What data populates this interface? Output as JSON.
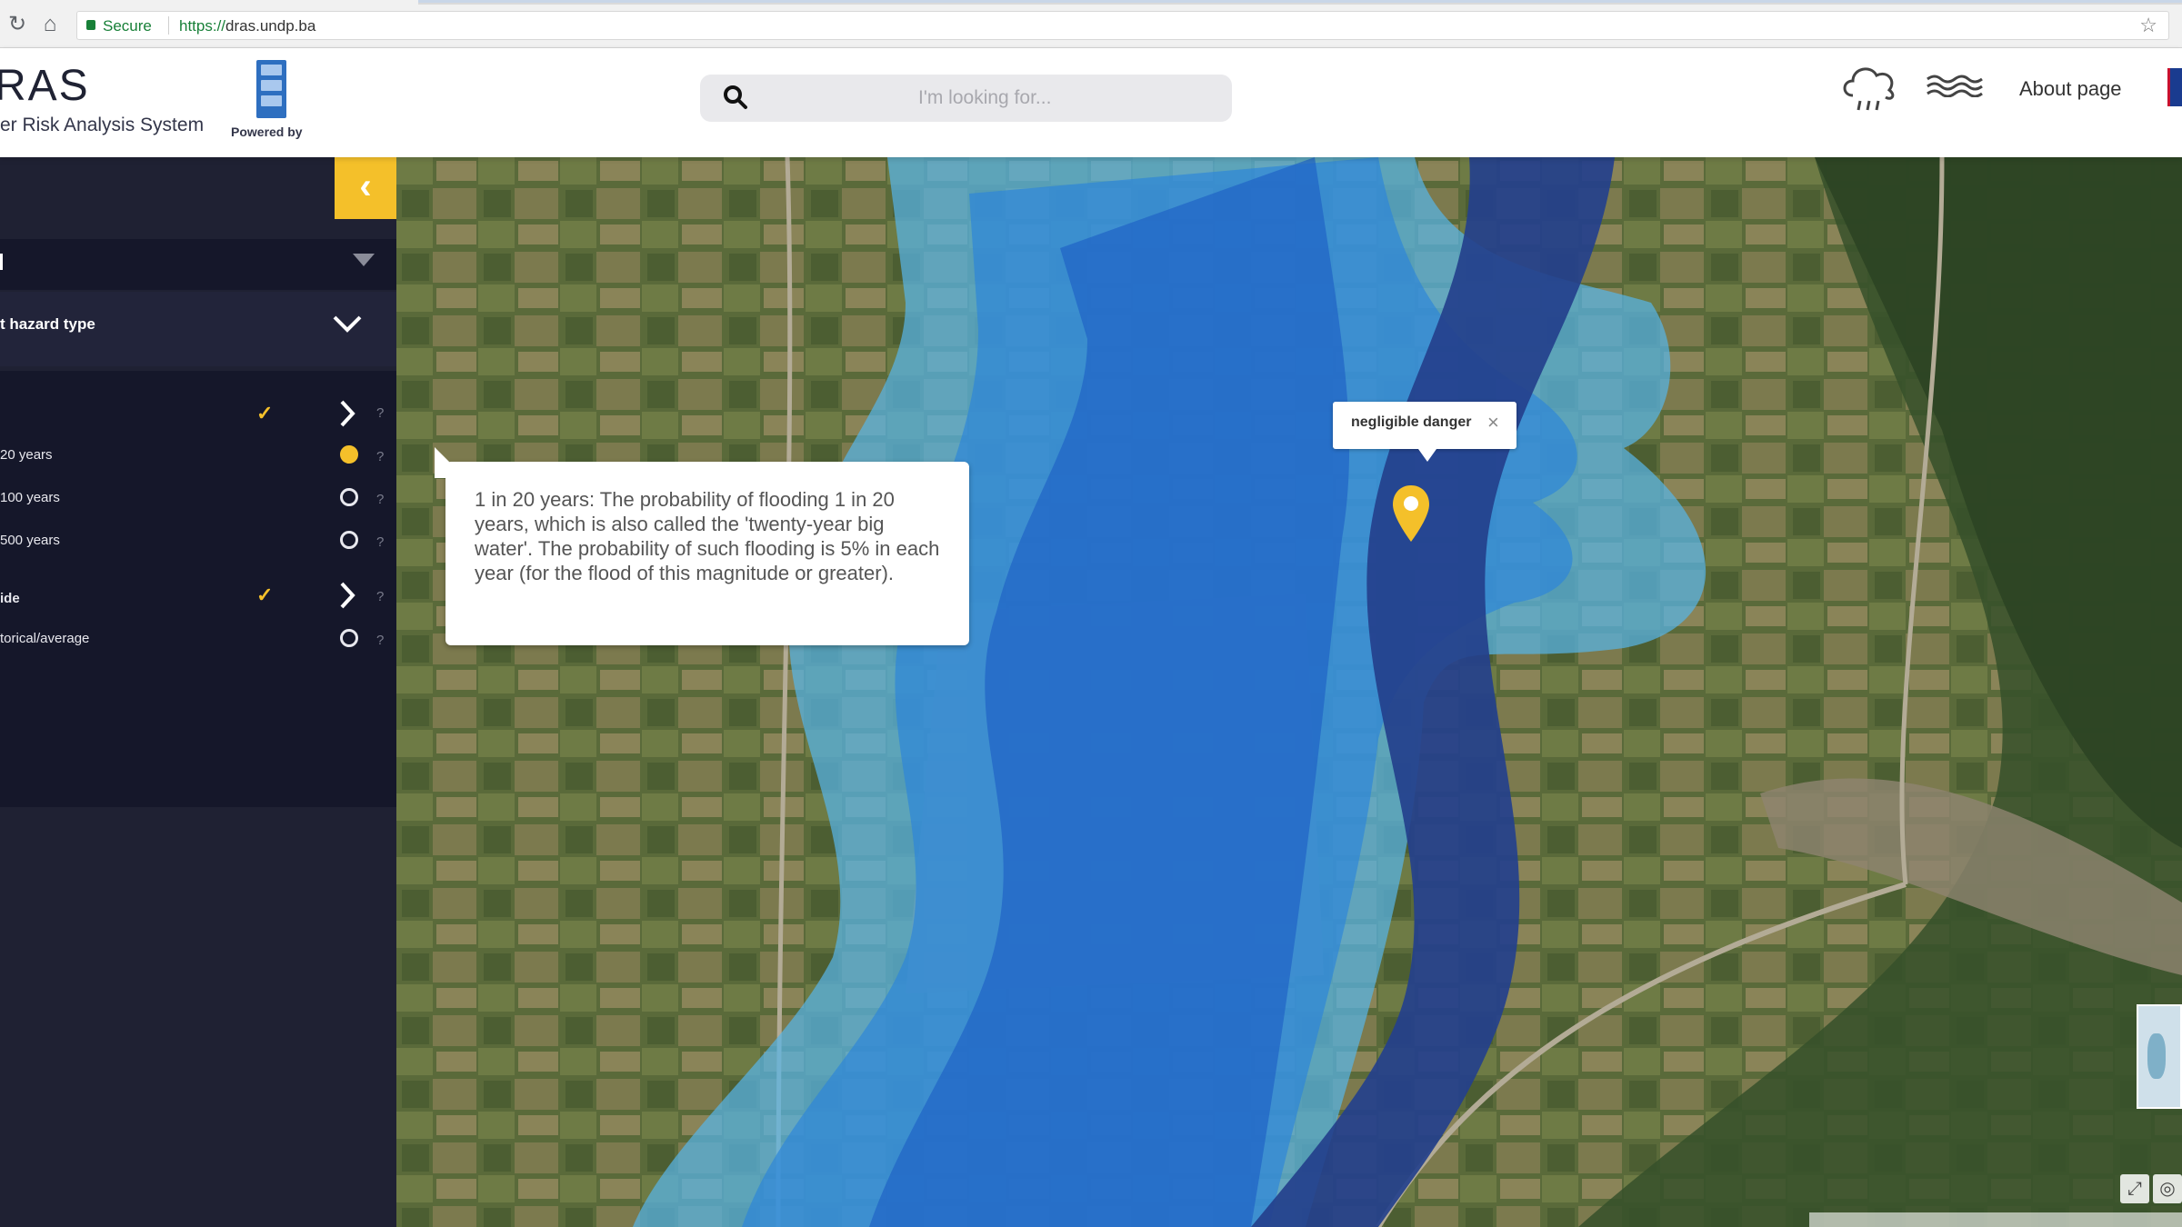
{
  "browser": {
    "secure_label": "Secure",
    "url_scheme": "https://",
    "url_host": "dras.undp.ba"
  },
  "header": {
    "brand_title": "RAS",
    "brand_subtitle": "er Risk Analysis System",
    "powered_by": "Powered by",
    "search_placeholder": "I'm looking for...",
    "about_label": "About page",
    "icons": [
      "search-icon",
      "weather-cloud-icon",
      "flood-waves-icon",
      "language-flag-icon"
    ]
  },
  "sidebar": {
    "collapse_symbol": "‹",
    "hazard_type_label": "t hazard type",
    "groups": [
      {
        "label": "",
        "checked": true,
        "items": [
          {
            "label": "20 years",
            "selected": true
          },
          {
            "label": "100 years",
            "selected": false
          },
          {
            "label": "500 years",
            "selected": false
          }
        ]
      },
      {
        "label": "ide",
        "checked": true,
        "items": [
          {
            "label": "torical/average",
            "selected": false
          }
        ]
      }
    ],
    "help_symbol": "?",
    "check_symbol": "✓"
  },
  "map": {
    "tooltip_text": "1 in 20 years: The probability of flooding 1 in 20 years, which is also called the 'twenty-year big water'. The probability of such flooding is 5% in each year (for the flood of this magnitude or greater).",
    "popup_text": "negligible danger",
    "popup_close": "×",
    "colors": {
      "deep_water": "#24408c",
      "flood_high": "#1f62c6",
      "flood_medium": "#2e86d8",
      "flood_low": "#58b4e6",
      "pin": "#f4c02a",
      "accent": "#f4c02a"
    }
  }
}
